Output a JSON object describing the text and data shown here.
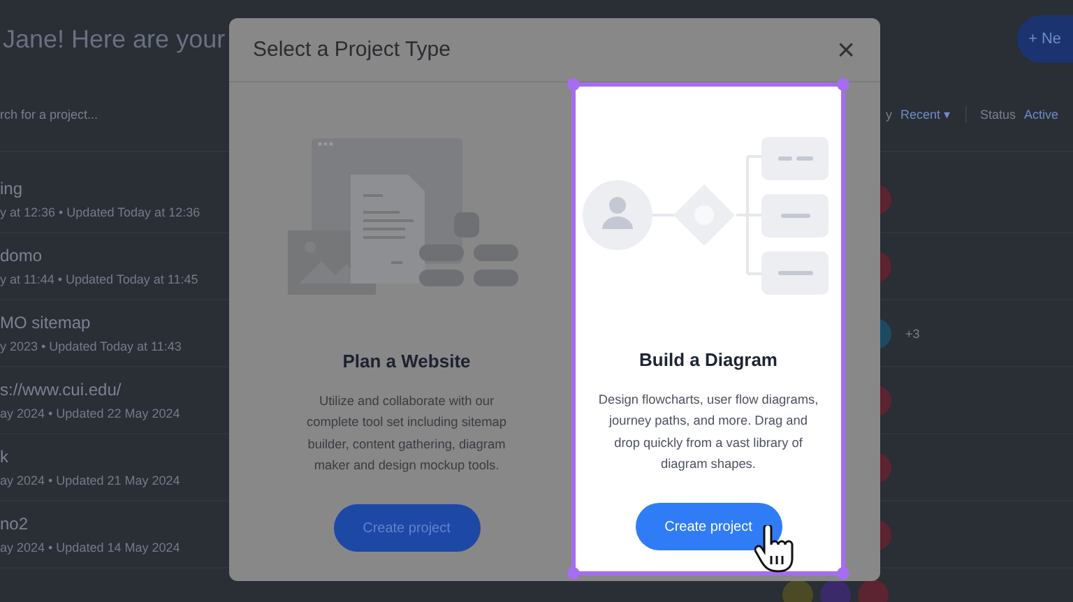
{
  "page": {
    "heading": "Jane! Here are your",
    "new_button": "+ Ne",
    "search": {
      "placeholder": "rch for a project..."
    },
    "filters": [
      {
        "label": "y",
        "value": "Recent ▾"
      },
      {
        "label": "Status",
        "value": "Active"
      }
    ],
    "projects": [
      {
        "name": "ing",
        "meta": "y at 12:36 • Updated Today at 12:36",
        "avatars": [
          {
            "color": "#5c2330"
          }
        ]
      },
      {
        "name": "domo",
        "meta": "y at 11:44 • Updated Today at 11:45",
        "avatars": [
          {
            "color": "#5c2330"
          }
        ]
      },
      {
        "name": "MO sitemap",
        "meta": "y 2023 • Updated Today at 11:43",
        "avatars": [
          {
            "color": "#1d4a62"
          }
        ],
        "extra": "+3"
      },
      {
        "name": "s://www.cui.edu/",
        "meta": "ay 2024 • Updated 22 May 2024",
        "avatars": [
          {
            "color": "#5c2330"
          }
        ]
      },
      {
        "name": "k",
        "meta": "ay 2024 • Updated 21 May 2024",
        "avatars": [
          {
            "color": "#5c2330"
          }
        ]
      },
      {
        "name": "no2",
        "meta": "ay 2024 • Updated 14 May 2024",
        "avatars": [
          {
            "color": "#5c2330"
          }
        ]
      }
    ],
    "footer_avatars": [
      {
        "color": "#4a4a24"
      },
      {
        "color": "#3b2a6a"
      },
      {
        "color": "#5c2330"
      }
    ]
  },
  "modal": {
    "title": "Select a Project Type",
    "close": "×",
    "options": [
      {
        "kind": "website",
        "title": "Plan a Website",
        "description": "Utilize and collaborate with our complete tool set including sitemap builder, content gathering, diagram maker and design mockup tools.",
        "button": "Create project",
        "selected": false
      },
      {
        "kind": "diagram",
        "title": "Build a Diagram",
        "description": "Design flowcharts, user flow diagrams, journey paths, and more. Drag and drop quickly from a vast library of diagram shapes.",
        "button": "Create project",
        "selected": true
      }
    ]
  }
}
